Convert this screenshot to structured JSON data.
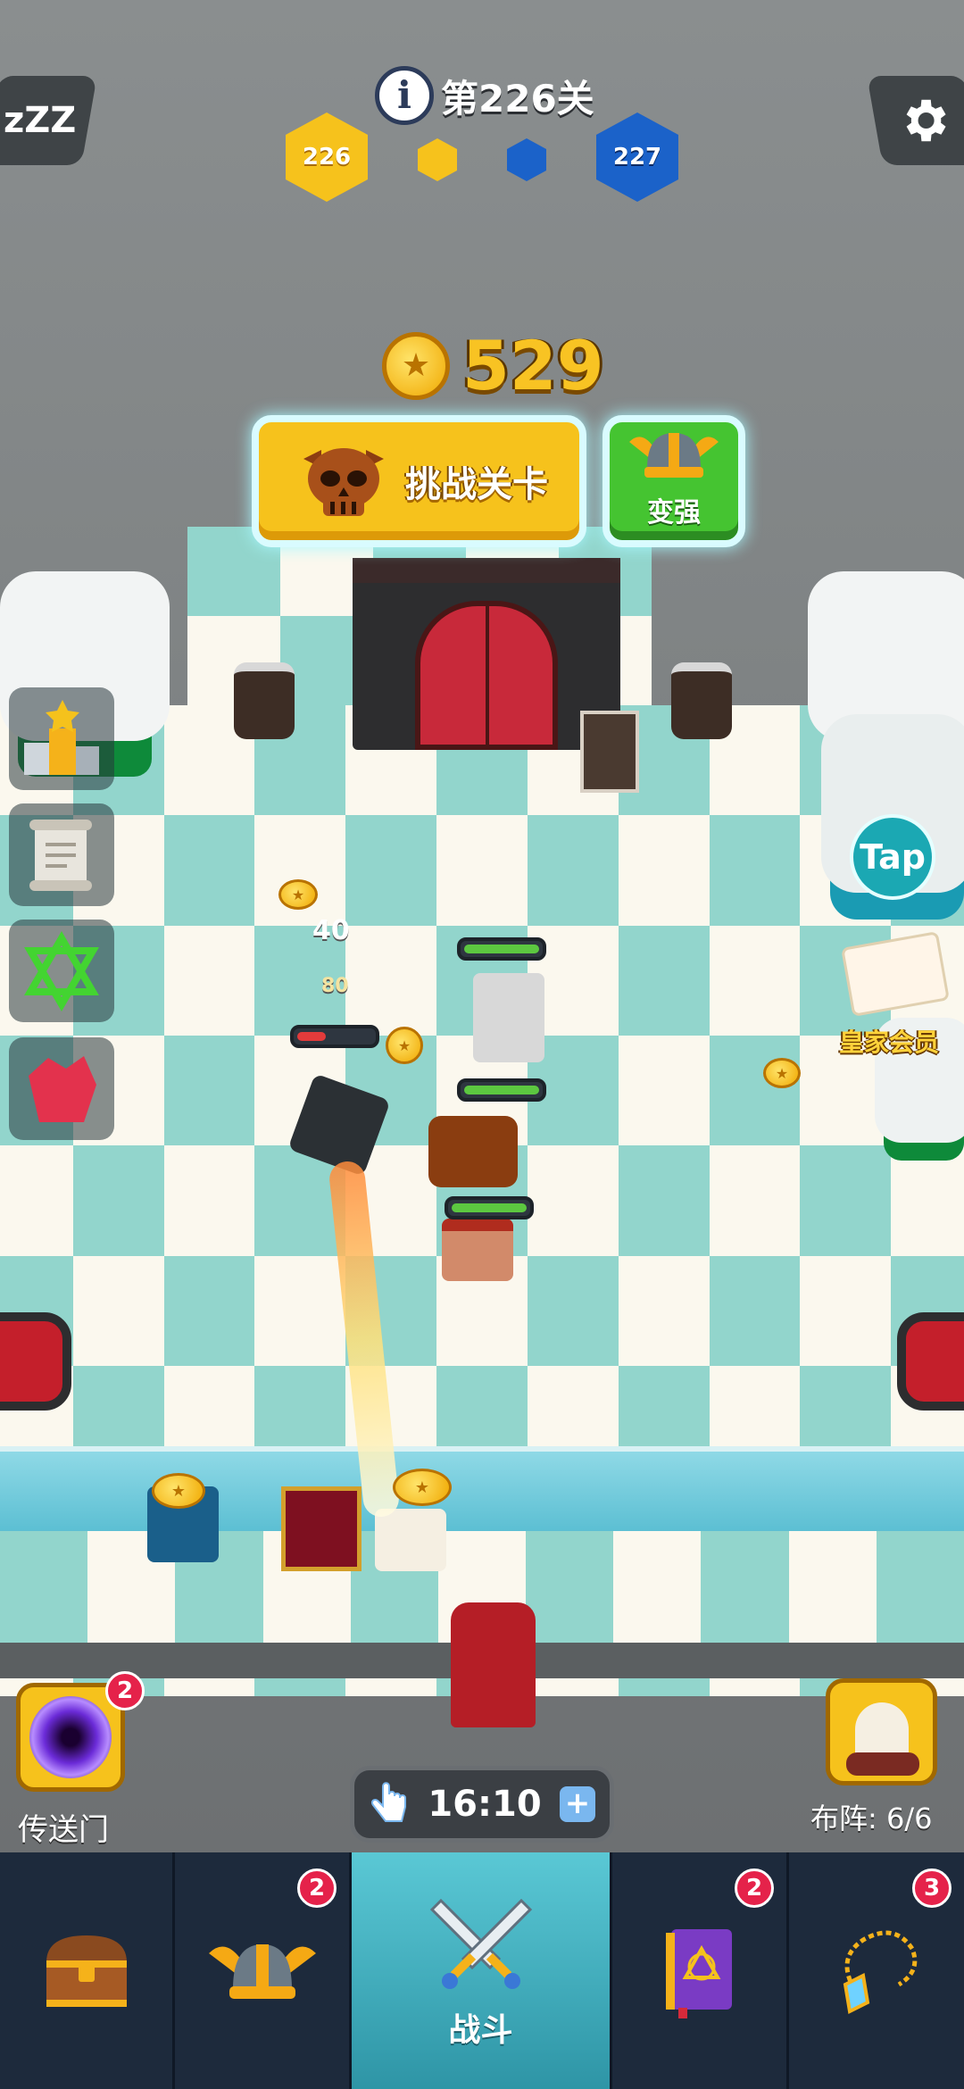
{
  "hud": {
    "level_title": "第226关",
    "current_level": "226",
    "next_level": "227",
    "sleep_label": "zZZ"
  },
  "coins": {
    "value": "529"
  },
  "actions": {
    "challenge_label": "挑战关卡",
    "stronger_label": "变强"
  },
  "right_side": {
    "tap_label": "Tap",
    "royal_label": "皇家会员"
  },
  "combat": {
    "float_damage_1": "40",
    "float_damage_2": "80"
  },
  "bottom": {
    "portal_label": "传送门",
    "portal_badge": "2",
    "timer": "16:10",
    "formation_label": "布阵: 6/6"
  },
  "nav": {
    "tabs": [
      {
        "name": "chest",
        "badge": ""
      },
      {
        "name": "helmet",
        "badge": "2"
      },
      {
        "name": "battle",
        "label": "战斗",
        "badge": ""
      },
      {
        "name": "spellbook",
        "badge": "2"
      },
      {
        "name": "amulet",
        "badge": "3"
      }
    ]
  },
  "colors": {
    "gold": "#f6c21c",
    "green": "#45c431",
    "teal_tile": "#92d5cc",
    "nav_bg": "#1d2a3c",
    "badge_red": "#e5224a"
  }
}
